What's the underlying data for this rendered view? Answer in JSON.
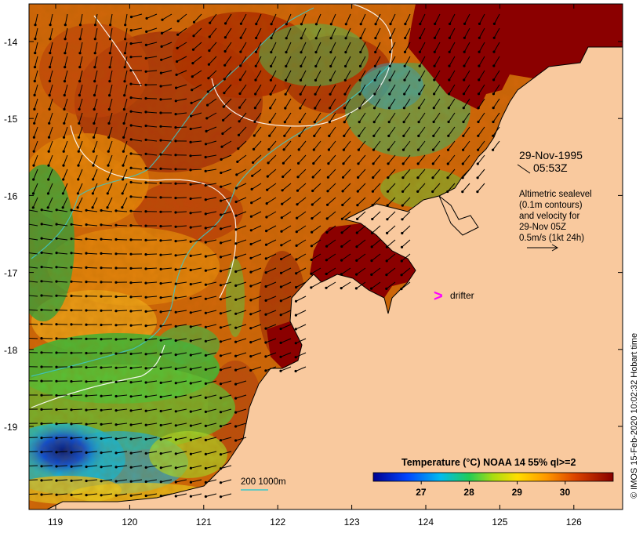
{
  "map": {
    "lat_ticks": [
      "-14",
      "-15",
      "-16",
      "-17",
      "-18",
      "-19"
    ],
    "lon_ticks": [
      "119",
      "120",
      "121",
      "122",
      "123",
      "124",
      "125",
      "126"
    ],
    "datetime": {
      "date": "29-Nov-1995",
      "time": "05:53Z"
    },
    "legend_text": {
      "line1": "Altimetric sealevel",
      "line2": "(0.1m contours)",
      "line3": "and velocity for",
      "line4": "29-Nov 05Z",
      "line5": "0.5m/s (1kt 24h)"
    },
    "drifter": {
      "symbol": ">",
      "label": "drifter"
    },
    "bathymetry_label": "200  1000m",
    "colorbar": {
      "title": "Temperature (°C) NOAA 14 55% ql>=2",
      "ticks": [
        "27",
        "28",
        "29",
        "30"
      ],
      "range": [
        26.0,
        31.0
      ]
    },
    "credit": "© IMOS 15-Feb-2020 10:02:32 Hobart time",
    "colors": {
      "land": "#f9c99e",
      "warm": "#b02c00",
      "hot": "#8b0000",
      "cool": "#22b24c",
      "cold": "#0a3cc8",
      "drifter": "#ff00ff",
      "contour": "#ffffff",
      "isobath": "#3ec8c8"
    }
  }
}
